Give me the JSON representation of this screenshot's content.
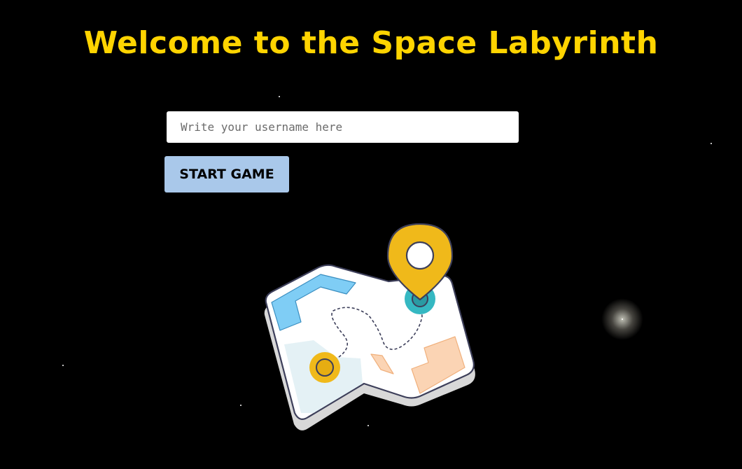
{
  "title": "Welcome to the Space Labyrinth",
  "username_input": {
    "placeholder": "Write your username here",
    "value": ""
  },
  "start_button": {
    "label": "START GAME"
  },
  "colors": {
    "background": "#000000",
    "title": "#ffd400",
    "button": "#a9c8ea",
    "pin": "#f0b91a",
    "water": "#7fcdf5",
    "marker_teal": "#35b8c2"
  },
  "illustration": {
    "icon": "map-with-location-pin-icon"
  }
}
